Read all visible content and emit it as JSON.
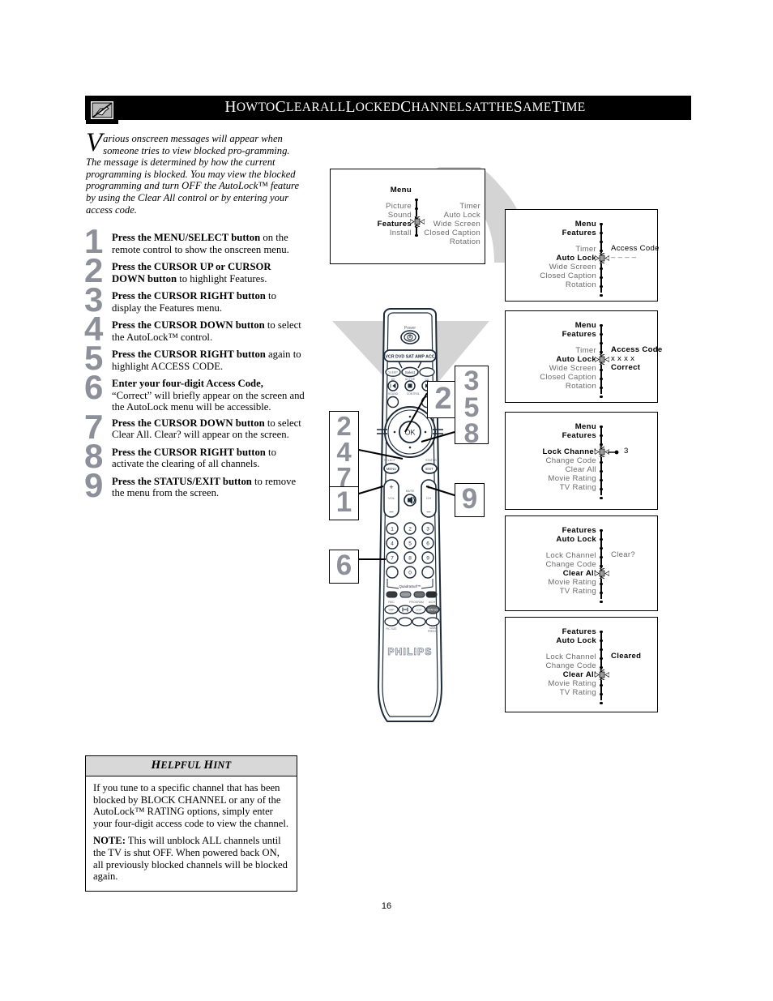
{
  "header": {
    "title_parts": [
      {
        "t": "H",
        "cap": true
      },
      {
        "t": "OW",
        "cap": false
      },
      {
        "t": " "
      },
      {
        "t": "TO",
        "cap": false
      },
      {
        "t": " "
      },
      {
        "t": "C",
        "cap": true
      },
      {
        "t": "LEAR",
        "cap": false
      },
      {
        "t": " "
      },
      {
        "t": "ALL",
        "cap": false
      },
      {
        "t": " "
      },
      {
        "t": "L",
        "cap": true
      },
      {
        "t": "OCKED",
        "cap": false
      },
      {
        "t": " "
      },
      {
        "t": "C",
        "cap": true
      },
      {
        "t": "HANNELS",
        "cap": false
      },
      {
        "t": " "
      },
      {
        "t": "AT",
        "cap": false
      },
      {
        "t": " "
      },
      {
        "t": "THE",
        "cap": false
      },
      {
        "t": " "
      },
      {
        "t": "S",
        "cap": true
      },
      {
        "t": "AME",
        "cap": false
      },
      {
        "t": " "
      },
      {
        "t": "T",
        "cap": true
      },
      {
        "t": "IME",
        "cap": false
      }
    ],
    "title_plain": "How to Clear all Locked Channels at the Same Time",
    "icon": "blocked-tv-icon"
  },
  "intro": {
    "dropcap": "V",
    "text": "arious onscreen messages will appear when someone tries to view blocked pro-gramming. The message is determined by how the current programming is blocked. You may view the blocked programming and turn OFF the AutoLock™ feature by using the Clear All control or by entering your access code."
  },
  "steps": [
    {
      "num": "1",
      "bold": "Press the MENU/SELECT button",
      "rest": " on the remote control to show the onscreen menu."
    },
    {
      "num": "2",
      "bold": "Press the CURSOR UP or CURSOR DOWN button",
      "rest": " to highlight Features."
    },
    {
      "num": "3",
      "bold": "Press the CURSOR RIGHT button",
      "rest": " to display the Features menu."
    },
    {
      "num": "4",
      "bold": "Press the CURSOR DOWN button",
      "rest": " to select the AutoLock™ control."
    },
    {
      "num": "5",
      "bold": "Press the CURSOR RIGHT button",
      "rest": " again to highlight ACCESS CODE."
    },
    {
      "num": "6",
      "bold": "Enter your four-digit Access Code,",
      "rest": " “Correct” will briefly appear on the screen and the AutoLock menu will be accessible."
    },
    {
      "num": "7",
      "bold": "Press the CURSOR DOWN button",
      "rest": " to select Clear All.  Clear? will appear on the screen."
    },
    {
      "num": "8",
      "bold": "Press the CURSOR RIGHT button",
      "rest": " to activate the clearing of all channels."
    },
    {
      "num": "9",
      "bold": "Press the STATUS/EXIT button",
      "rest": " to remove the menu from the screen."
    }
  ],
  "osd": {
    "top": {
      "header": [
        {
          "label": "Menu",
          "style": "bold"
        }
      ],
      "left_items": [
        {
          "label": "Picture",
          "style": "dim"
        },
        {
          "label": "Sound",
          "style": "dim"
        },
        {
          "label": "Features",
          "style": "bold"
        },
        {
          "label": "Install",
          "style": "dim"
        }
      ],
      "right_items": [
        {
          "label": "Timer",
          "style": "dim"
        },
        {
          "label": "Auto Lock",
          "style": "dim"
        },
        {
          "label": "Wide Screen",
          "style": "dim"
        },
        {
          "label": "Closed Caption",
          "style": "dim"
        },
        {
          "label": "Rotation",
          "style": "dim"
        }
      ],
      "cursor_on": "Features"
    },
    "boxes": [
      {
        "name": "access-code-empty",
        "breadcrumb": [
          {
            "label": "Menu",
            "style": "bold"
          },
          {
            "label": "Features",
            "style": "bold"
          }
        ],
        "items": [
          {
            "label": "Timer",
            "style": "dim"
          },
          {
            "label": "Auto Lock",
            "style": "bold"
          },
          {
            "label": "Wide Screen",
            "style": "dim"
          },
          {
            "label": "Closed Caption",
            "style": "dim"
          },
          {
            "label": "Rotation",
            "style": "dim"
          }
        ],
        "cursor_index": 1,
        "right": [
          {
            "label": "Access Code",
            "style": "nrm"
          },
          {
            "label": "– – – –",
            "style": "dim"
          }
        ]
      },
      {
        "name": "access-code-correct",
        "breadcrumb": [
          {
            "label": "Menu",
            "style": "bold"
          },
          {
            "label": "Features",
            "style": "bold"
          }
        ],
        "items": [
          {
            "label": "Timer",
            "style": "dim"
          },
          {
            "label": "Auto Lock",
            "style": "bold"
          },
          {
            "label": "Wide Screen",
            "style": "dim"
          },
          {
            "label": "Closed Caption",
            "style": "dim"
          },
          {
            "label": "Rotation",
            "style": "dim"
          }
        ],
        "cursor_index": 1,
        "right": [
          {
            "label": "Access Code",
            "style": "bold"
          },
          {
            "label": "x x x x",
            "style": "nrm"
          },
          {
            "label": "Correct",
            "style": "bold"
          }
        ]
      },
      {
        "name": "lock-channel",
        "breadcrumb": [
          {
            "label": "Menu",
            "style": "bold"
          },
          {
            "label": "Features",
            "style": "bold"
          }
        ],
        "items": [
          {
            "label": "Lock Channel",
            "style": "bold"
          },
          {
            "label": "Change Code",
            "style": "dim"
          },
          {
            "label": "Clear All",
            "style": "dim"
          },
          {
            "label": "Movie Rating",
            "style": "dim"
          },
          {
            "label": "TV Rating",
            "style": "dim"
          }
        ],
        "cursor_index": 0,
        "right": [
          {
            "label": "3",
            "style": "nrm"
          }
        ],
        "right_arrow": true
      },
      {
        "name": "clear-all-prompt",
        "breadcrumb": [
          {
            "label": "Features",
            "style": "bold"
          },
          {
            "label": "Auto Lock",
            "style": "bold"
          }
        ],
        "items": [
          {
            "label": "Lock Channel",
            "style": "dim"
          },
          {
            "label": "Change Code",
            "style": "dim"
          },
          {
            "label": "Clear All",
            "style": "bold"
          },
          {
            "label": "Movie Rating",
            "style": "dim"
          },
          {
            "label": "TV Rating",
            "style": "dim"
          }
        ],
        "cursor_index": 2,
        "right": [
          {
            "label": "Clear?",
            "style": "dim"
          }
        ]
      },
      {
        "name": "cleared-confirm",
        "breadcrumb": [
          {
            "label": "Features",
            "style": "bold"
          },
          {
            "label": "Auto Lock",
            "style": "bold"
          }
        ],
        "items": [
          {
            "label": "Lock Channel",
            "style": "dim"
          },
          {
            "label": "Change Code",
            "style": "dim"
          },
          {
            "label": "Clear All",
            "style": "bold"
          },
          {
            "label": "Movie Rating",
            "style": "dim"
          },
          {
            "label": "TV Rating",
            "style": "dim"
          }
        ],
        "cursor_index": 2,
        "right": [
          {
            "label": "Cleared",
            "style": "bold"
          }
        ]
      }
    ]
  },
  "remote": {
    "brand": "PHILIPS",
    "power_label": "Power",
    "device_row": "VCR DVD SAT AMP ACC",
    "sleep_label": "SLEEP",
    "select_label": "Select",
    "av_label": "AV",
    "active_label": "ACTIVE",
    "cc_label": "CC",
    "sound_label": "SOUND",
    "control_label": "CONTROL",
    "ok_label": "OK",
    "menu_btn_label": "MENU",
    "exit_btn_label": "EXIT",
    "select_side_label": "SELECT",
    "status_side_label": "STATUS",
    "vol_label": "VOL",
    "ch_label": "CH",
    "mute_label": "MUTE",
    "keypad": [
      "1",
      "2",
      "3",
      "4",
      "5",
      "6",
      "7",
      "8",
      "9",
      "0"
    ],
    "quadrasurf_label": "QuadraSurf™",
    "rec_label": "REC",
    "program_label": "PROGRAM",
    "ach_label": "A/CH",
    "sap_label": "SAP",
    "list_label": "LIST",
    "status_label": "STATUS",
    "picsize_label": "PIC SIZE",
    "mainfreeze_label": "MAIN FREEZE"
  },
  "callouts": [
    {
      "id": "co-2",
      "value": "2"
    },
    {
      "id": "co-358",
      "value": "3\n5\n8",
      "lines": [
        "3",
        "5",
        "8"
      ]
    },
    {
      "id": "co-247",
      "value": "2\n4\n7",
      "lines": [
        "2",
        "4",
        "7"
      ]
    },
    {
      "id": "co-1",
      "value": "1"
    },
    {
      "id": "co-9",
      "value": "9"
    },
    {
      "id": "co-6",
      "value": "6"
    }
  ],
  "hint": {
    "title_plain": "Helpful Hint",
    "title_parts": [
      {
        "t": "H",
        "cap": true
      },
      {
        "t": "ELPFUL",
        "cap": false
      },
      {
        "t": " "
      },
      {
        "t": "H",
        "cap": true
      },
      {
        "t": "INT",
        "cap": false
      }
    ],
    "paragraph1": "If you tune to a specific channel that has been blocked by BLOCK CHANNEL or any of the AutoLock™ RATING options, simply enter your four-digit access code to view the channel.",
    "note_label": "NOTE:",
    "paragraph2": " This will unblock ALL channels until the TV is shut OFF. When powered back ON, all previously blocked channels will be blocked again."
  },
  "page_number": "16",
  "colors": {
    "callout_gray": "#8d9099",
    "hint_header_gray": "#d8d8d8",
    "arrow_gray": "#d4d4d4",
    "osd_dim": "#6b6b6b"
  }
}
